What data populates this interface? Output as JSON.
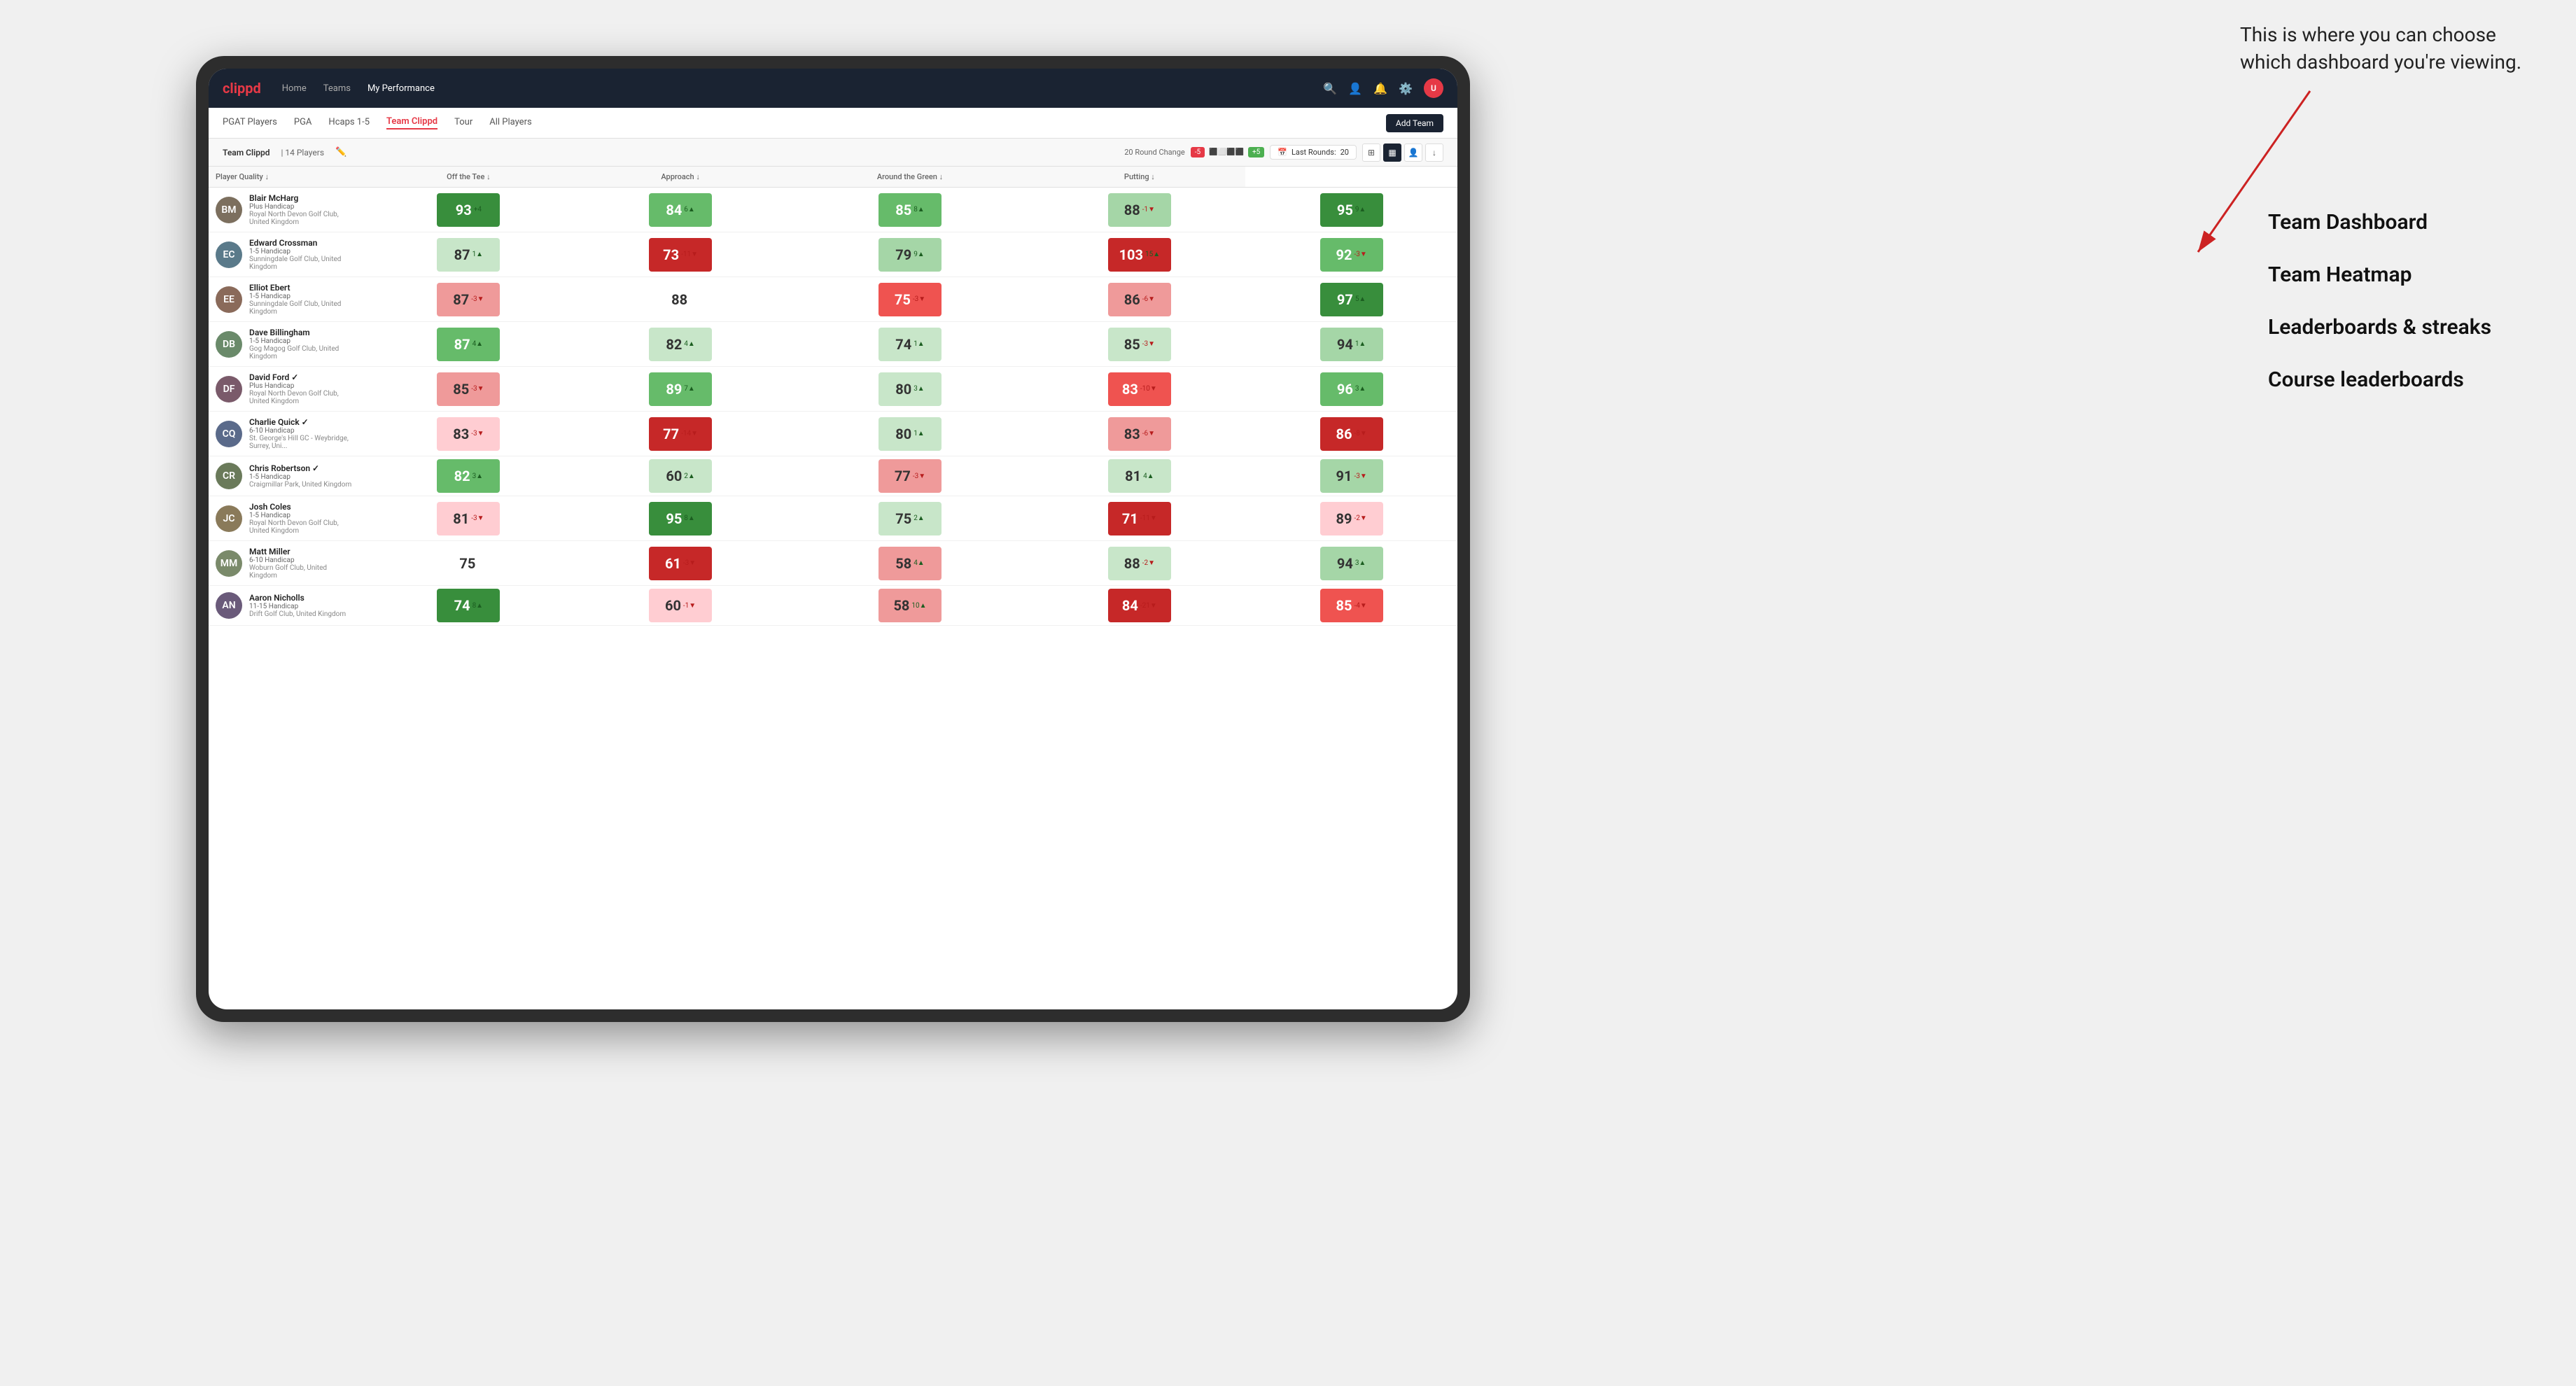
{
  "annotation": {
    "intro_text": "This is where you can choose which dashboard you're viewing.",
    "items": [
      {
        "id": "team-dashboard",
        "label": "Team Dashboard"
      },
      {
        "id": "team-heatmap",
        "label": "Team Heatmap"
      },
      {
        "id": "leaderboards",
        "label": "Leaderboards & streaks"
      },
      {
        "id": "course-leaderboards",
        "label": "Course leaderboards"
      }
    ]
  },
  "nav": {
    "logo": "clippd",
    "links": [
      {
        "id": "home",
        "label": "Home",
        "active": false
      },
      {
        "id": "teams",
        "label": "Teams",
        "active": false
      },
      {
        "id": "my-performance",
        "label": "My Performance",
        "active": true
      }
    ],
    "icons": [
      "search",
      "person",
      "notifications",
      "settings",
      "avatar"
    ]
  },
  "sub_nav": {
    "links": [
      {
        "id": "pgat",
        "label": "PGAT Players",
        "active": false
      },
      {
        "id": "pga",
        "label": "PGA",
        "active": false
      },
      {
        "id": "hcaps",
        "label": "Hcaps 1-5",
        "active": false
      },
      {
        "id": "team-clippd",
        "label": "Team Clippd",
        "active": true
      },
      {
        "id": "tour",
        "label": "Tour",
        "active": false
      },
      {
        "id": "all-players",
        "label": "All Players",
        "active": false
      }
    ],
    "add_team_label": "Add Team"
  },
  "team_header": {
    "team_name": "Team Clippd",
    "separator": "|",
    "player_count": "14 Players",
    "round_change_label": "20 Round Change",
    "badge_minus": "-5",
    "badge_plus": "+5",
    "last_rounds_label": "Last Rounds:",
    "last_rounds_value": "20",
    "view_modes": [
      "grid",
      "heatmap",
      "person",
      "download"
    ]
  },
  "table": {
    "columns": [
      {
        "id": "player",
        "label": "Player Quality ↓"
      },
      {
        "id": "off-tee",
        "label": "Off the Tee ↓"
      },
      {
        "id": "approach",
        "label": "Approach ↓"
      },
      {
        "id": "around-green",
        "label": "Around the Green ↓"
      },
      {
        "id": "putting",
        "label": "Putting ↓"
      }
    ],
    "rows": [
      {
        "id": "blair-mcharg",
        "name": "Blair McHarg",
        "handicap": "Plus Handicap",
        "club": "Royal North Devon Golf Club, United Kingdom",
        "avatar_color": "#7c6f5e",
        "avatar_initials": "BM",
        "player_quality": {
          "value": 93,
          "change": "+4",
          "direction": "up",
          "color": "color-green-dark"
        },
        "off_tee": {
          "value": 84,
          "change": "6▲",
          "direction": "up",
          "color": "color-green-mid"
        },
        "approach": {
          "value": 85,
          "change": "8▲",
          "direction": "up",
          "color": "color-green-mid"
        },
        "around_green": {
          "value": 88,
          "change": "-1▼",
          "direction": "down",
          "color": "color-green-light"
        },
        "putting": {
          "value": 95,
          "change": "9▲",
          "direction": "up",
          "color": "color-green-dark"
        }
      },
      {
        "id": "edward-crossman",
        "name": "Edward Crossman",
        "handicap": "1-5 Handicap",
        "club": "Sunningdale Golf Club, United Kingdom",
        "avatar_color": "#5a7a8a",
        "avatar_initials": "EC",
        "player_quality": {
          "value": 87,
          "change": "1▲",
          "direction": "up",
          "color": "color-green-pale"
        },
        "off_tee": {
          "value": 73,
          "change": "-11▼",
          "direction": "down",
          "color": "color-red-dark"
        },
        "approach": {
          "value": 79,
          "change": "9▲",
          "direction": "up",
          "color": "color-green-light"
        },
        "around_green": {
          "value": 103,
          "change": "15▲",
          "direction": "up",
          "color": "color-red-dark"
        },
        "putting": {
          "value": 92,
          "change": "-3▼",
          "direction": "down",
          "color": "color-green-mid"
        }
      },
      {
        "id": "elliot-ebert",
        "name": "Elliot Ebert",
        "handicap": "1-5 Handicap",
        "club": "Sunningdale Golf Club, United Kingdom",
        "avatar_color": "#8a6a5a",
        "avatar_initials": "EE",
        "player_quality": {
          "value": 87,
          "change": "-3▼",
          "direction": "down",
          "color": "color-red-light"
        },
        "off_tee": {
          "value": 88,
          "change": "",
          "direction": "neutral",
          "color": "color-white"
        },
        "approach": {
          "value": 75,
          "change": "-3▼",
          "direction": "down",
          "color": "color-red-mid"
        },
        "around_green": {
          "value": 86,
          "change": "-6▼",
          "direction": "down",
          "color": "color-red-light"
        },
        "putting": {
          "value": 97,
          "change": "5▲",
          "direction": "up",
          "color": "color-green-dark"
        }
      },
      {
        "id": "dave-billingham",
        "name": "Dave Billingham",
        "handicap": "1-5 Handicap",
        "club": "Gog Magog Golf Club, United Kingdom",
        "avatar_color": "#6a8a6a",
        "avatar_initials": "DB",
        "player_quality": {
          "value": 87,
          "change": "4▲",
          "direction": "up",
          "color": "color-green-mid"
        },
        "off_tee": {
          "value": 82,
          "change": "4▲",
          "direction": "up",
          "color": "color-green-pale"
        },
        "approach": {
          "value": 74,
          "change": "1▲",
          "direction": "up",
          "color": "color-green-pale"
        },
        "around_green": {
          "value": 85,
          "change": "-3▼",
          "direction": "down",
          "color": "color-green-pale"
        },
        "putting": {
          "value": 94,
          "change": "1▲",
          "direction": "up",
          "color": "color-green-light"
        }
      },
      {
        "id": "david-ford",
        "name": "David Ford ✓",
        "handicap": "Plus Handicap",
        "club": "Royal North Devon Golf Club, United Kingdom",
        "avatar_color": "#7a5a6a",
        "avatar_initials": "DF",
        "player_quality": {
          "value": 85,
          "change": "-3▼",
          "direction": "down",
          "color": "color-red-light"
        },
        "off_tee": {
          "value": 89,
          "change": "7▲",
          "direction": "up",
          "color": "color-green-mid"
        },
        "approach": {
          "value": 80,
          "change": "3▲",
          "direction": "up",
          "color": "color-green-pale"
        },
        "around_green": {
          "value": 83,
          "change": "-10▼",
          "direction": "down",
          "color": "color-red-mid"
        },
        "putting": {
          "value": 96,
          "change": "3▲",
          "direction": "up",
          "color": "color-green-mid"
        }
      },
      {
        "id": "charlie-quick",
        "name": "Charlie Quick ✓",
        "handicap": "6-10 Handicap",
        "club": "St. George's Hill GC - Weybridge, Surrey, Uni...",
        "avatar_color": "#5a6a8a",
        "avatar_initials": "CQ",
        "player_quality": {
          "value": 83,
          "change": "-3▼",
          "direction": "down",
          "color": "color-red-pale"
        },
        "off_tee": {
          "value": 77,
          "change": "-14▼",
          "direction": "down",
          "color": "color-red-dark"
        },
        "approach": {
          "value": 80,
          "change": "1▲",
          "direction": "up",
          "color": "color-green-pale"
        },
        "around_green": {
          "value": 83,
          "change": "-6▼",
          "direction": "down",
          "color": "color-red-light"
        },
        "putting": {
          "value": 86,
          "change": "-8▼",
          "direction": "down",
          "color": "color-red-dark"
        }
      },
      {
        "id": "chris-robertson",
        "name": "Chris Robertson ✓",
        "handicap": "1-5 Handicap",
        "club": "Craigmillar Park, United Kingdom",
        "avatar_color": "#6a7a5a",
        "avatar_initials": "CR",
        "player_quality": {
          "value": 82,
          "change": "3▲",
          "direction": "up",
          "color": "color-green-mid"
        },
        "off_tee": {
          "value": 60,
          "change": "2▲",
          "direction": "up",
          "color": "color-green-pale"
        },
        "approach": {
          "value": 77,
          "change": "-3▼",
          "direction": "down",
          "color": "color-red-light"
        },
        "around_green": {
          "value": 81,
          "change": "4▲",
          "direction": "up",
          "color": "color-green-pale"
        },
        "putting": {
          "value": 91,
          "change": "-3▼",
          "direction": "down",
          "color": "color-green-light"
        }
      },
      {
        "id": "josh-coles",
        "name": "Josh Coles",
        "handicap": "1-5 Handicap",
        "club": "Royal North Devon Golf Club, United Kingdom",
        "avatar_color": "#8a7a5a",
        "avatar_initials": "JC",
        "player_quality": {
          "value": 81,
          "change": "-3▼",
          "direction": "down",
          "color": "color-red-pale"
        },
        "off_tee": {
          "value": 95,
          "change": "8▲",
          "direction": "up",
          "color": "color-green-dark"
        },
        "approach": {
          "value": 75,
          "change": "2▲",
          "direction": "up",
          "color": "color-green-pale"
        },
        "around_green": {
          "value": 71,
          "change": "-11▼",
          "direction": "down",
          "color": "color-red-dark"
        },
        "putting": {
          "value": 89,
          "change": "-2▼",
          "direction": "down",
          "color": "color-red-pale"
        }
      },
      {
        "id": "matt-miller",
        "name": "Matt Miller",
        "handicap": "6-10 Handicap",
        "club": "Woburn Golf Club, United Kingdom",
        "avatar_color": "#7a8a6a",
        "avatar_initials": "MM",
        "player_quality": {
          "value": 75,
          "change": "",
          "direction": "neutral",
          "color": "color-white"
        },
        "off_tee": {
          "value": 61,
          "change": "-3▼",
          "direction": "down",
          "color": "color-red-dark"
        },
        "approach": {
          "value": 58,
          "change": "4▲",
          "direction": "up",
          "color": "color-red-light"
        },
        "around_green": {
          "value": 88,
          "change": "-2▼",
          "direction": "down",
          "color": "color-green-pale"
        },
        "putting": {
          "value": 94,
          "change": "3▲",
          "direction": "up",
          "color": "color-green-light"
        }
      },
      {
        "id": "aaron-nicholls",
        "name": "Aaron Nicholls",
        "handicap": "11-15 Handicap",
        "club": "Drift Golf Club, United Kingdom",
        "avatar_color": "#6a5a7a",
        "avatar_initials": "AN",
        "player_quality": {
          "value": 74,
          "change": "8▲",
          "direction": "up",
          "color": "color-green-dark"
        },
        "off_tee": {
          "value": 60,
          "change": "-1▼",
          "direction": "down",
          "color": "color-red-pale"
        },
        "approach": {
          "value": 58,
          "change": "10▲",
          "direction": "up",
          "color": "color-red-light"
        },
        "around_green": {
          "value": 84,
          "change": "-21▼",
          "direction": "down",
          "color": "color-red-dark"
        },
        "putting": {
          "value": 85,
          "change": "-4▼",
          "direction": "down",
          "color": "color-red-mid"
        }
      }
    ]
  }
}
